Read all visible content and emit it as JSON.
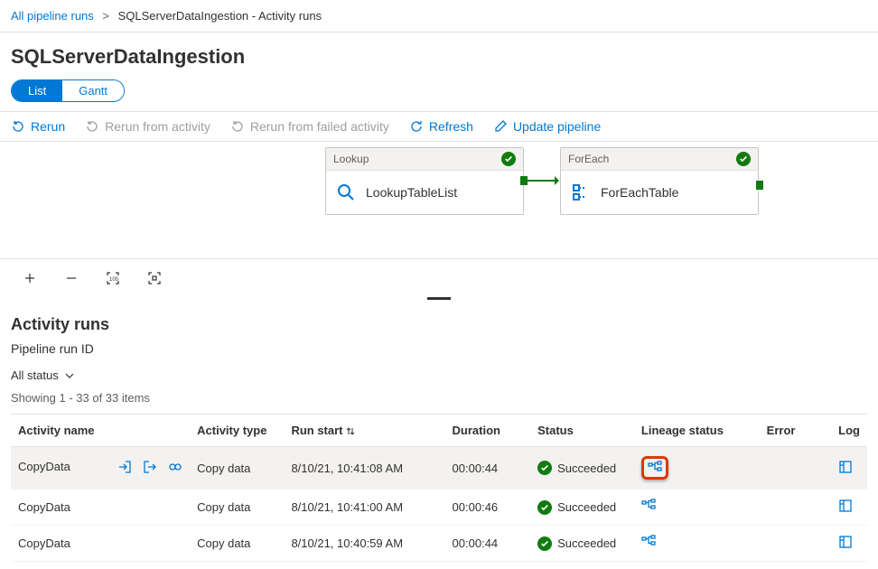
{
  "breadcrumb": {
    "root": "All pipeline runs",
    "current": "SQLServerDataIngestion - Activity runs"
  },
  "title": "SQLServerDataIngestion",
  "tabs": {
    "list": "List",
    "gantt": "Gantt"
  },
  "toolbar": {
    "rerun": "Rerun",
    "rerun_activity": "Rerun from activity",
    "rerun_failed": "Rerun from failed activity",
    "refresh": "Refresh",
    "update": "Update pipeline"
  },
  "nodes": {
    "lookup": {
      "type": "Lookup",
      "name": "LookupTableList"
    },
    "foreach": {
      "type": "ForEach",
      "name": "ForEachTable"
    }
  },
  "activity": {
    "heading": "Activity runs",
    "run_id_label": "Pipeline run ID",
    "filter": "All status",
    "showing_prefix": "Showing ",
    "showing_range": "1",
    "showing_rest": " - 33 of 33 items"
  },
  "columns": {
    "name": "Activity name",
    "type": "Activity type",
    "start": "Run start",
    "duration": "Duration",
    "status": "Status",
    "lineage": "Lineage status",
    "error": "Error",
    "log": "Log"
  },
  "rows": [
    {
      "name": "CopyData",
      "type": "Copy data",
      "start": "8/10/21, 10:41:08 AM",
      "duration": "00:00:44",
      "status": "Succeeded",
      "hovered": true,
      "highlight_lineage": true
    },
    {
      "name": "CopyData",
      "type": "Copy data",
      "start": "8/10/21, 10:41:00 AM",
      "duration": "00:00:46",
      "status": "Succeeded",
      "hovered": false,
      "highlight_lineage": false
    },
    {
      "name": "CopyData",
      "type": "Copy data",
      "start": "8/10/21, 10:40:59 AM",
      "duration": "00:00:44",
      "status": "Succeeded",
      "hovered": false,
      "highlight_lineage": false
    }
  ]
}
